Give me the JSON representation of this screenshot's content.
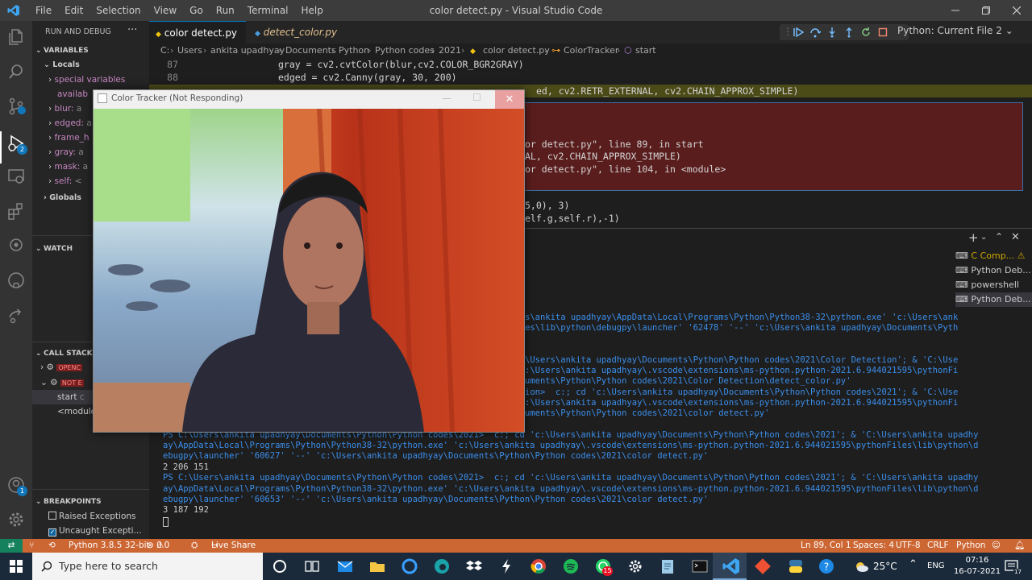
{
  "window": {
    "title": "color detect.py - Visual Studio Code",
    "menu": [
      "File",
      "Edit",
      "Selection",
      "View",
      "Go",
      "Run",
      "Terminal",
      "Help"
    ]
  },
  "activity_badges": {
    "run": "2",
    "accounts": "1"
  },
  "sidebar": {
    "header": "RUN AND DEBUG",
    "variables_title": "VARIABLES",
    "locals_label": "Locals",
    "variables": [
      {
        "name": "special variables",
        "value": ""
      },
      {
        "name": "availab",
        "value": ""
      },
      {
        "name": "blur:",
        "value": "a"
      },
      {
        "name": "edged:",
        "value": "a"
      },
      {
        "name": "frame_h",
        "value": ""
      },
      {
        "name": "gray:",
        "value": "a"
      },
      {
        "name": "mask:",
        "value": "a"
      },
      {
        "name": "self:",
        "value": "<"
      }
    ],
    "globals_label": "Globals",
    "watch_title": "WATCH",
    "callstack_title": "CALL STACK",
    "callstack": [
      {
        "badge": "OPENC"
      },
      {
        "badge": "NOT E"
      }
    ],
    "frames": [
      {
        "name": "start",
        "extra": "c"
      },
      {
        "name": "<module",
        "extra": ""
      }
    ],
    "breakpoints_title": "BREAKPOINTS",
    "breakpoints": [
      {
        "label": "Raised Exceptions",
        "checked": false
      },
      {
        "label": "Uncaught Excepti...",
        "checked": true
      }
    ]
  },
  "tabs": [
    {
      "label": "color detect.py",
      "active": true,
      "close": "×"
    },
    {
      "label": "detect_color.py",
      "active": false,
      "modified": "M"
    }
  ],
  "debug_config": "Python: Current File 2",
  "breadcrumb": [
    "C:",
    "Users",
    "ankita upadhyay",
    "Documents",
    "Python",
    "Python codes",
    "2021",
    "color detect.py",
    "ColorTracker",
    "start"
  ],
  "code": [
    {
      "line": "87",
      "text": "gray = cv2.cvtColor(blur,cv2.COLOR_BGR2GRAY)"
    },
    {
      "line": "88",
      "text": "edged = cv2.Canny(gray, 30, 200)"
    },
    {
      "line": "",
      "text": "ed, cv2.RETR_EXTERNAL, cv2.CHAIN_APPROX_SIMPLE)"
    }
  ],
  "exception_lines": [
    "or detect.py\", line 89, in start",
    "AL, cv2.CHAIN_APPROX_SIMPLE)",
    "or detect.py\", line 104, in <module>"
  ],
  "code_after": [
    "5,0), 3)",
    "elf.g,self.r),-1)"
  ],
  "terminal_list": [
    "C Comp...",
    "Python Deb...",
    "powershell",
    "Python Deb..."
  ],
  "terminal_partial": [
    "s\\ankita upadhyay\\AppData\\Local\\Programs\\Python\\Python38-32\\python.exe' 'c:\\Users\\ank",
    "es\\lib\\python\\debugpy\\launcher' '62478' '--' 'c:\\Users\\ankita upadhyay\\Documents\\Pyth",
    "\\Users\\ankita upadhyay\\Documents\\Python\\Python codes\\2021\\Color Detection'; & 'C:\\Use",
    ":\\Users\\ankita upadhyay\\.vscode\\extensions\\ms-python.python-2021.6.944021595\\pythonFi",
    "uments\\Python\\Python codes\\2021\\Color Detection\\detect_color.py'",
    "ion>  c:; cd 'c:\\Users\\ankita upadhyay\\Documents\\Python\\Python codes\\2021'; & 'C:\\Use",
    ":\\Users\\ankita upadhyay\\.vscode\\extensions\\ms-python.python-2021.6.944021595\\pythonFi",
    "uments\\Python\\Python codes\\2021\\color detect.py'"
  ],
  "terminal_full": [
    "PS C:\\Users\\ankita upadhyay\\Documents\\Python\\Python codes\\2021>  c:; cd 'c:\\Users\\ankita upadhyay\\Documents\\Python\\Python codes\\2021'; & 'C:\\Users\\ankita upadhy",
    "ay\\AppData\\Local\\Programs\\Python\\Python38-32\\python.exe' 'c:\\Users\\ankita upadhyay\\.vscode\\extensions\\ms-python.python-2021.6.944021595\\pythonFiles\\lib\\python\\d",
    "ebugpy\\launcher' '60627' '--' 'c:\\Users\\ankita upadhyay\\Documents\\Python\\Python codes\\2021\\color detect.py'",
    "2 206 151",
    "PS C:\\Users\\ankita upadhyay\\Documents\\Python\\Python codes\\2021>  c:; cd 'c:\\Users\\ankita upadhyay\\Documents\\Python\\Python codes\\2021'; & 'C:\\Users\\ankita upadhy",
    "ay\\AppData\\Local\\Programs\\Python\\Python38-32\\python.exe' 'c:\\Users\\ankita upadhyay\\.vscode\\extensions\\ms-python.python-2021.6.944021595\\pythonFiles\\lib\\python\\d",
    "ebugpy\\launcher' '60653' '--' 'c:\\Users\\ankita upadhyay\\Documents\\Python\\Python codes\\2021\\color detect.py'",
    "3 187 192"
  ],
  "tracker": {
    "title": "Color Tracker (Not Responding)"
  },
  "status": {
    "interpreter": "Python 3.8.5 32-bit",
    "errors": "0",
    "warnings": "0",
    "live_share": "Live Share",
    "position": "Ln 89, Col 1",
    "spaces": "Spaces: 4",
    "encoding": "UTF-8",
    "eol": "CRLF",
    "language": "Python"
  },
  "taskbar": {
    "search_placeholder": "Type here to search",
    "weather": "25°C",
    "lang": "ENG",
    "time": "07:16",
    "date": "16-07-2021",
    "notif_count": "17",
    "whatsapp_badge": "15"
  },
  "colors": {
    "status_bar": "#cc6633",
    "accent": "#007acc",
    "exception_bg": "#5a1d1d",
    "highlight_line": "#4b4b18"
  }
}
